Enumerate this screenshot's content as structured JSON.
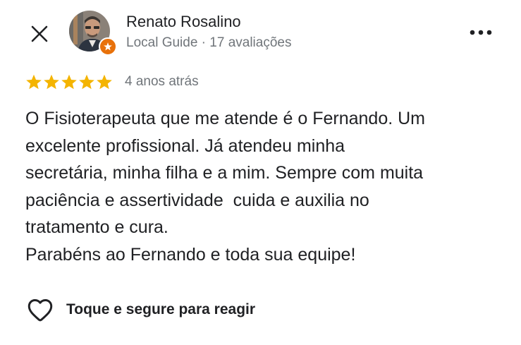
{
  "author": {
    "name": "Renato Rosalino",
    "meta": "Local Guide · 17 avaliações",
    "avatar_icon": "profile-photo",
    "badge_icon": "local-guide-star-icon"
  },
  "header": {
    "close_icon": "close-icon",
    "more_icon": "more-horizontal-icon"
  },
  "review": {
    "stars": 5,
    "max_stars": 5,
    "star_color": "#f4b400",
    "date": "4 anos atrás",
    "text": "O Fisioterapeuta que me atende é o Fernando. Um\nexcelente profissional. Já atendeu minha\nsecretária, minha filha e a mim. Sempre com muita\npaciência e assertividade  cuida e auxilia no\ntratamento e cura.\nParabéns ao Fernando e toda sua equipe!"
  },
  "reaction": {
    "label": "Toque e segure para reagir",
    "icon": "heart-outline-icon"
  },
  "colors": {
    "badge": "#e8710a",
    "secondary_text": "#70757a",
    "primary_text": "#202124"
  }
}
